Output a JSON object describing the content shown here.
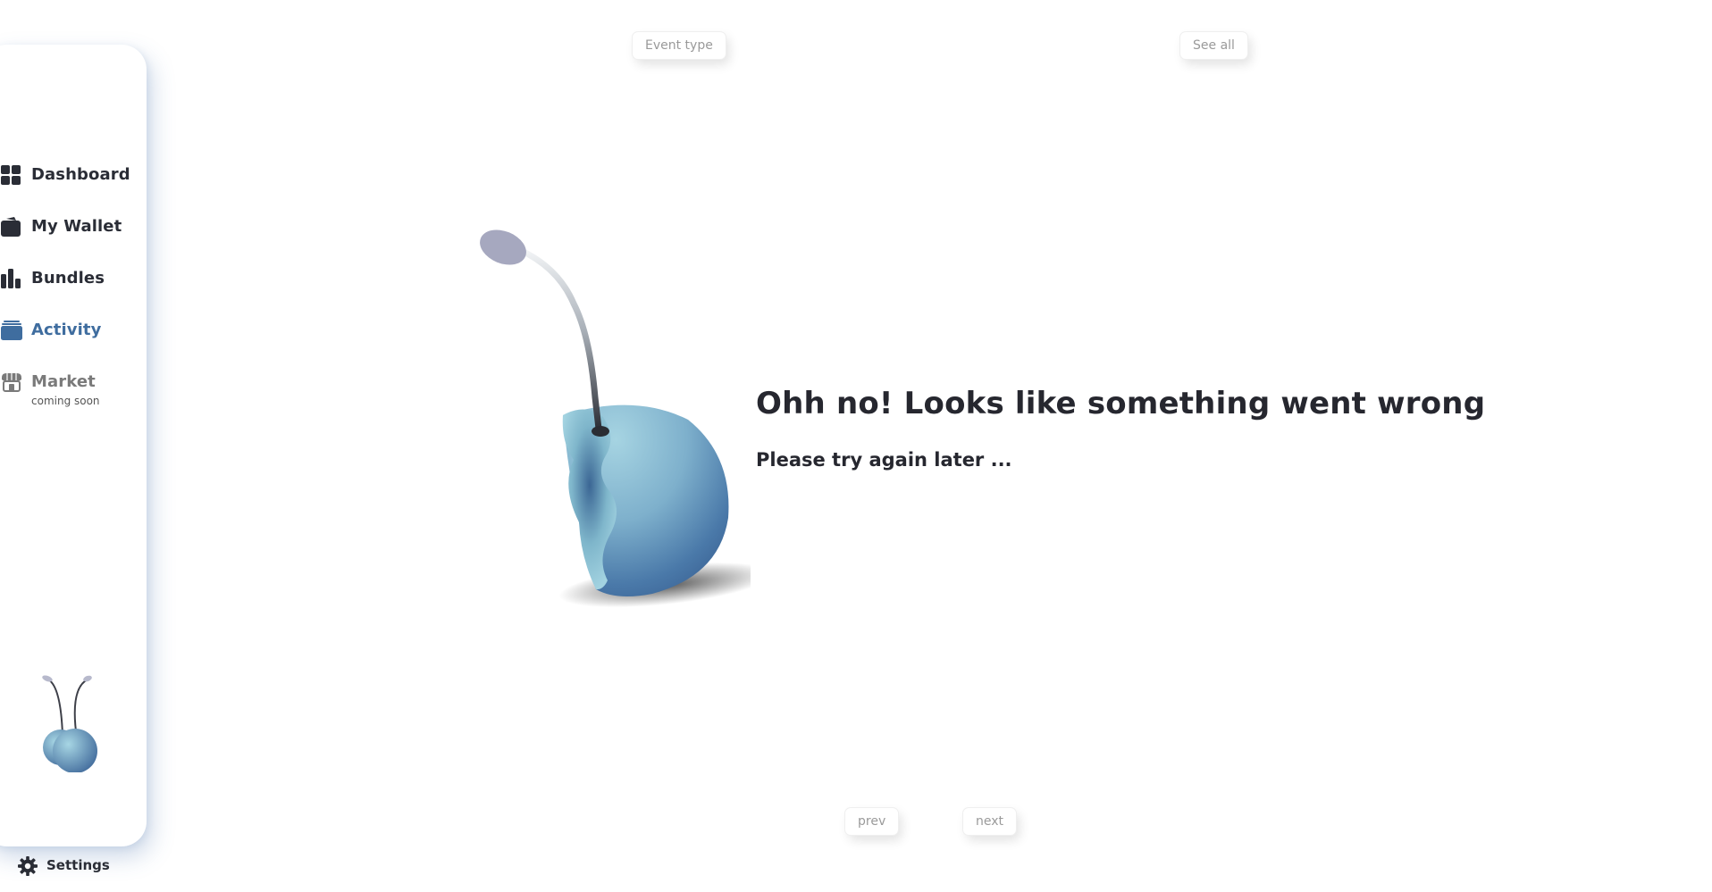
{
  "sidebar": {
    "items": [
      {
        "label": "Dashboard",
        "icon": "dashboard-grid-icon"
      },
      {
        "label": "My Wallet",
        "icon": "wallet-icon"
      },
      {
        "label": "Bundles",
        "icon": "bar-chart-icon"
      },
      {
        "label": "Activity",
        "icon": "stack-icon",
        "active": true
      },
      {
        "label": "Market",
        "sublabel": "coming soon",
        "icon": "market-icon",
        "disabled": true
      }
    ],
    "settings_label": "Settings",
    "logo": "cherries-logo"
  },
  "toolbar": {
    "event_type_label": "Event type",
    "see_all_label": "See all"
  },
  "error": {
    "title": "Ohh no! Looks like something went wrong",
    "message": "Please try again later ...",
    "illustration": "bitten-cherry-illustration"
  },
  "pagination": {
    "prev_label": "prev",
    "next_label": "next"
  },
  "colors": {
    "accent": "#3f6d9f",
    "text": "#23262f",
    "muted": "#9a9a9a",
    "cherry_light": "#9fd0df",
    "cherry_dark": "#3d6a9c"
  }
}
